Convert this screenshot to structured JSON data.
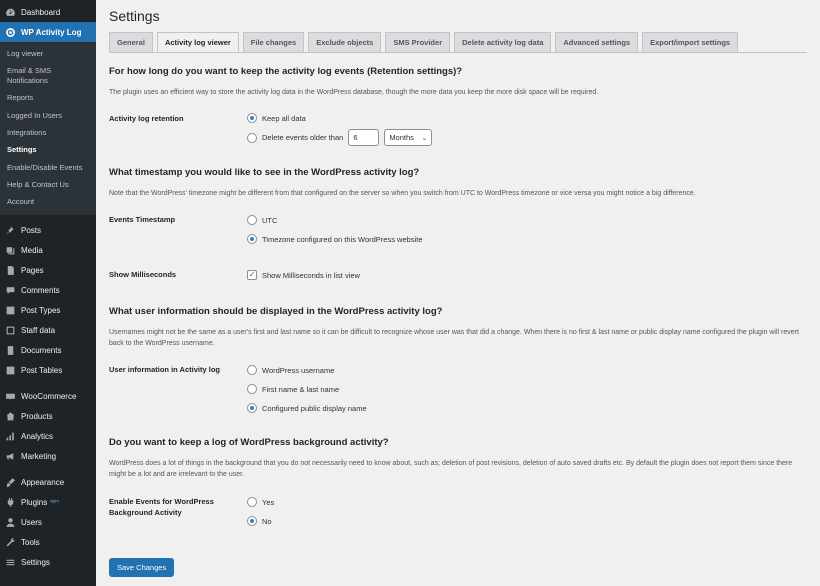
{
  "sidebar": {
    "dashboard": "Dashboard",
    "plugin": "WP Activity Log",
    "submenu": [
      "Log viewer",
      "Email & SMS Notifications",
      "Reports",
      "Logged In Users",
      "Integrations",
      "Settings",
      "Enable/Disable Events",
      "Help & Contact Us",
      "Account"
    ],
    "menu": [
      "Posts",
      "Media",
      "Pages",
      "Comments",
      "Post Types",
      "Staff data",
      "Documents",
      "Post Tables",
      "WooCommerce",
      "Products",
      "Analytics",
      "Marketing",
      "Appearance",
      "Plugins",
      "Users",
      "Tools",
      "Settings"
    ]
  },
  "page": {
    "title": "Settings",
    "tabs": [
      "General",
      "Activity log viewer",
      "File changes",
      "Exclude objects",
      "SMS Provider",
      "Delete activity log data",
      "Advanced settings",
      "Export/import settings"
    ]
  },
  "retention": {
    "title": "For how long do you want to keep the activity log events (Retention settings)?",
    "desc": "The plugin uses an efficient way to store the activity log data in the WordPress database, though the more data you keep the more disk space will be required.",
    "label": "Activity log retention",
    "opt_keep": "Keep all data",
    "opt_delete": "Delete events older than",
    "value": "6",
    "unit": "Months"
  },
  "timestamp": {
    "title": "What timestamp you would like to see in the WordPress activity log?",
    "desc": "Note that the WordPress' timezone might be different from that configured on the server so when you switch from UTC to WordPress timezone or vice versa you might notice a big difference.",
    "label": "Events Timestamp",
    "opt_utc": "UTC",
    "opt_tz": "Timezone configured on this WordPress website",
    "ms_label": "Show Milliseconds",
    "ms_opt": "Show Milliseconds in list view"
  },
  "userinfo": {
    "title": "What user information should be displayed in the WordPress activity log?",
    "desc": "Usernames might not be the same as a user's first and last name so it can be difficult to recognize whose user was that did a change. When there is no first & last name or public display name configured the plugin will revert back to the WordPress username.",
    "label": "User information in Activity log",
    "opt1": "WordPress username",
    "opt2": "First name & last name",
    "opt3": "Configured public display name"
  },
  "background": {
    "title": "Do you want to keep a log of WordPress background activity?",
    "desc": "WordPress does a lot of things in the background that you do not necessarily need to know about, such as; deletion of post revisions, deletion of auto saved drafts etc. By default the plugin does not report them since there might be a lot and are irrelevant to the user.",
    "label": "Enable Events for WordPress Background Activity",
    "yes": "Yes",
    "no": "No"
  },
  "save_label": "Save Changes"
}
